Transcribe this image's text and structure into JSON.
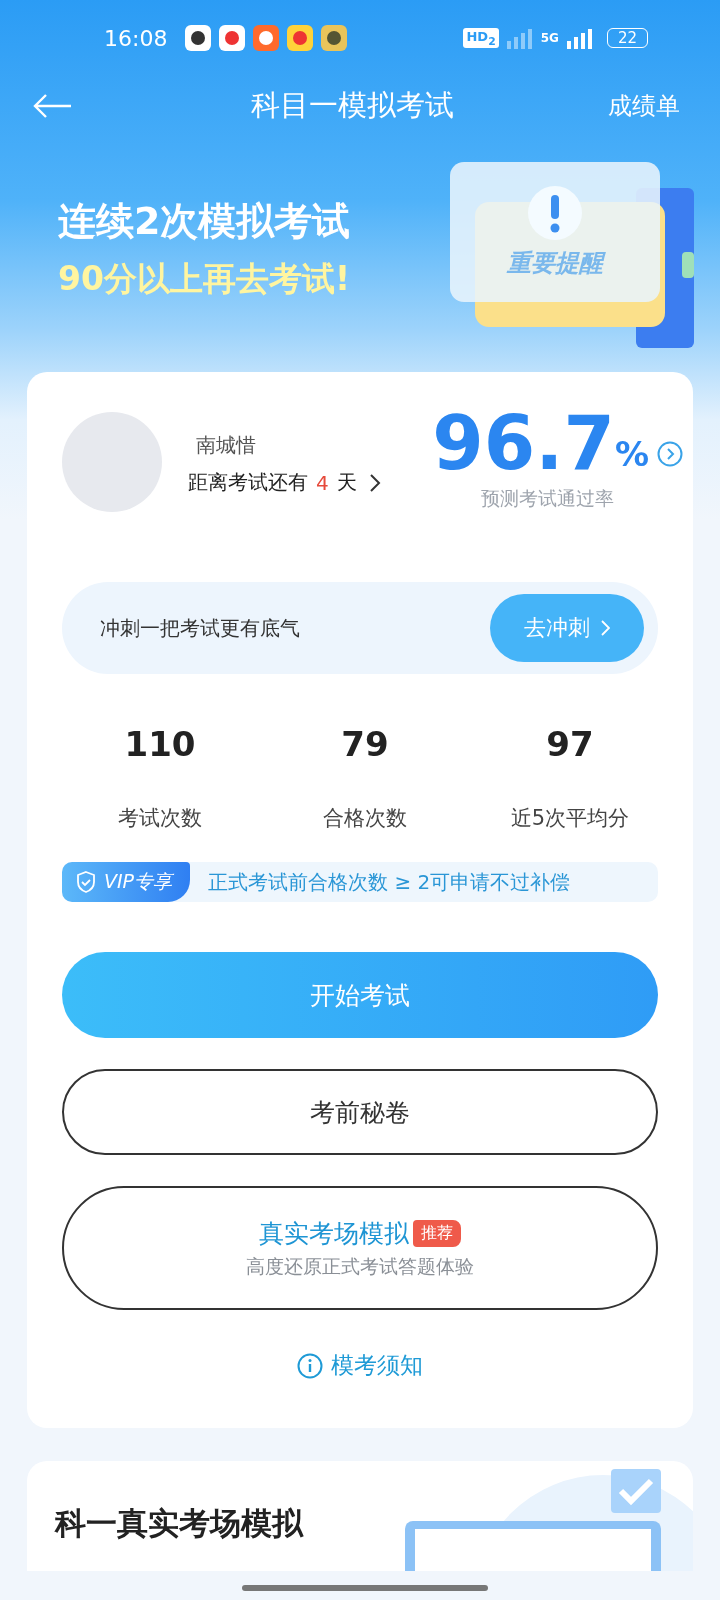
{
  "status_bar": {
    "time": "16:08",
    "hd_badge": "HD$_{2}$",
    "network": "5G",
    "battery": "22"
  },
  "header": {
    "title": "科目一模拟考试",
    "action": "成绩单"
  },
  "banner": {
    "line_1": "连续2次模拟考试",
    "line_2": "90分以上再去考试!",
    "badge_text": "重要提醒"
  },
  "profile": {
    "name": "南城惜",
    "countdown_prefix": "距离考试还有",
    "countdown_days": "4",
    "countdown_suffix": "天",
    "pass_rate": "96.7",
    "pass_rate_unit": "%",
    "pass_rate_caption": "预测考试通过率"
  },
  "sprint": {
    "text": "冲刺一把考试更有底气",
    "button": "去冲刺"
  },
  "stats": [
    {
      "value": "110",
      "label": "考试次数"
    },
    {
      "value": "79",
      "label": "合格次数"
    },
    {
      "value": "97",
      "label": "近5次平均分"
    }
  ],
  "vip": {
    "tag": "VIP专享",
    "text": "正式考试前合格次数 ≥ 2可申请不过补偿"
  },
  "actions": [
    {
      "kind": "primary",
      "label": "开始考试"
    },
    {
      "kind": "outline",
      "label": "考前秘卷"
    },
    {
      "kind": "featured",
      "label": "真实考场模拟",
      "tag": "推荐",
      "subtitle": "高度还原正式考试答题体验"
    }
  ],
  "notice_link": "模考须知",
  "section": {
    "title": "科一真实考场模拟"
  }
}
